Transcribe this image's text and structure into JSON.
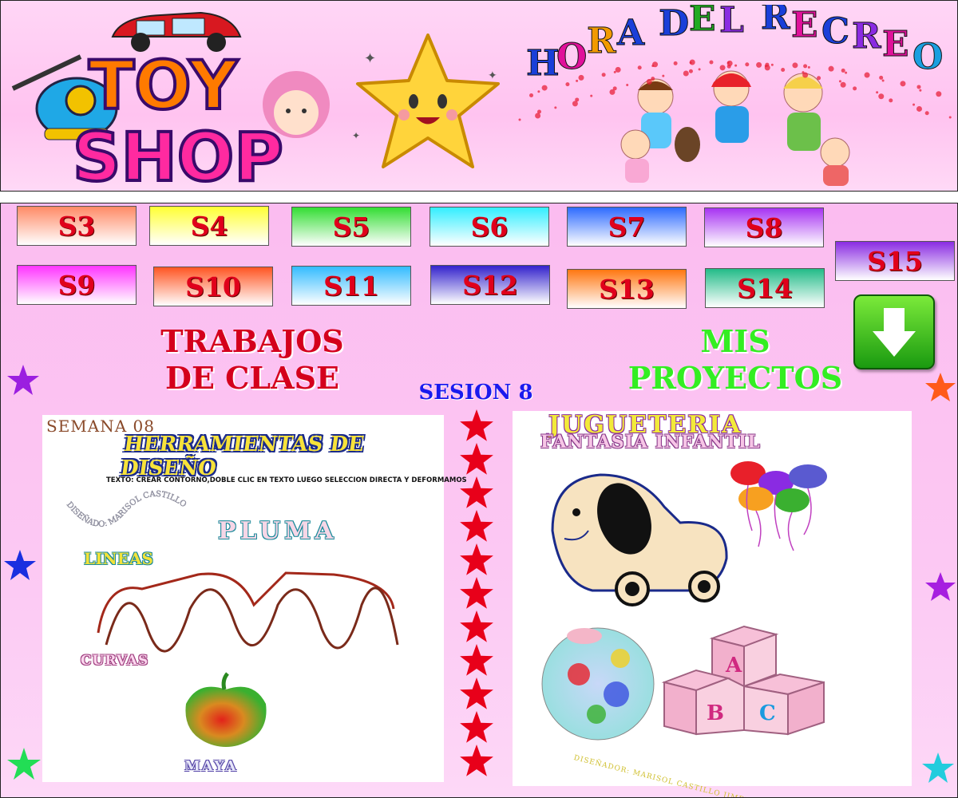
{
  "banner": {
    "logo_line1": "TOY",
    "logo_line2": "SHOP",
    "title_letters": [
      "H",
      "O",
      "R",
      "A",
      " ",
      "D",
      "E",
      "L",
      " ",
      "R",
      "E",
      "C",
      "R",
      "E",
      "O"
    ],
    "title_colors": [
      "#1a3fd9",
      "#e0119a",
      "#f29a00",
      "#1a3fd9",
      "",
      "#1a3fd9",
      "#22aa22",
      "#8a2be2",
      "",
      "#1a3fd9",
      "#e0119a",
      "#1a3fd9",
      "#8a2be2",
      "#e0119a",
      "#1a9fe0"
    ]
  },
  "sessions": {
    "row1": [
      {
        "label": "S3",
        "bg": "linear-gradient(180deg,#ff8a66,#fff)"
      },
      {
        "label": "S4",
        "bg": "linear-gradient(180deg,#ffff33,#fff)"
      },
      {
        "label": "S5",
        "bg": "linear-gradient(180deg,#33dd33,#fff)"
      },
      {
        "label": "S6",
        "bg": "linear-gradient(180deg,#33eeff,#fff)"
      },
      {
        "label": "S7",
        "bg": "linear-gradient(180deg,#2e6bff,#fff)"
      },
      {
        "label": "S8",
        "bg": "linear-gradient(180deg,#a733f2,#fff)"
      },
      {
        "label": "S15",
        "bg": "linear-gradient(180deg,#8a2be2,#fff)"
      }
    ],
    "row2": [
      {
        "label": "S9",
        "bg": "linear-gradient(180deg,#ff33ff,#fff)"
      },
      {
        "label": "S10",
        "bg": "linear-gradient(180deg,#ff5522,#fff)"
      },
      {
        "label": "S11",
        "bg": "linear-gradient(180deg,#33bbff,#fff)"
      },
      {
        "label": "S12",
        "bg": "linear-gradient(180deg,#3322cc,#fff)"
      },
      {
        "label": "S13",
        "bg": "linear-gradient(180deg,#ff7711,#fff)"
      },
      {
        "label": "S14",
        "bg": "linear-gradient(180deg,#22bb88,#fff)"
      }
    ]
  },
  "headings": {
    "trabajos_line1": "TRABAJOS",
    "trabajos_line2": "DE CLASE",
    "proyectos_line1": "MIS",
    "proyectos_line2": "PROYECTOS",
    "sesion": "SESION 8"
  },
  "left_panel": {
    "semana": "SEMANA 08",
    "title": "HERRAMIENTAS DE DISEÑO",
    "instruction": "TEXTO: CREAR CONTORNO,DOBLE CLIC EN TEXTO LUEGO SELECCION DIRECTA Y DEFORMAMOS",
    "curved_text": "DISEÑADO: MARISOL CASTILLO",
    "pluma": "PLUMA",
    "lineas": "LINEAS",
    "curvas": "CURVAS",
    "maya": "MAYA"
  },
  "right_panel": {
    "title1": "JUGUETERIA",
    "title2": "FANTASIA INFANTIL",
    "block_letters": [
      "A",
      "B",
      "C"
    ],
    "designer": "DISEÑADOR: MARISOL CASTILLO JIMENEZ"
  },
  "colors": {
    "session_text": "#e0001b",
    "trabajos": "#d4001c",
    "proyectos": "#33ee22",
    "sesion": "#1a1aee",
    "star_red": "#e8001a"
  }
}
